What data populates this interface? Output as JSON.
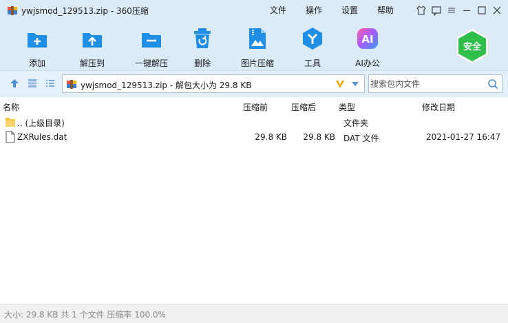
{
  "window": {
    "title": "ywjsmod_129513.zip - 360压缩",
    "menu": [
      "文件",
      "操作",
      "设置",
      "帮助"
    ]
  },
  "toolbar": {
    "items": [
      {
        "label": "添加",
        "icon": "add-archive-icon"
      },
      {
        "label": "解压到",
        "icon": "extract-to-icon"
      },
      {
        "label": "一键解压",
        "icon": "one-click-extract-icon"
      },
      {
        "label": "删除",
        "icon": "delete-icon"
      },
      {
        "label": "图片压缩",
        "icon": "image-compress-icon"
      },
      {
        "label": "工具",
        "icon": "tools-icon"
      },
      {
        "label": "AI办公",
        "icon": "ai-office-icon"
      }
    ],
    "ai_badge": "AI",
    "security_badge": "安全"
  },
  "address": {
    "path": "ywjsmod_129513.zip - 解包大小为 29.8 KB",
    "search_placeholder": "搜索包内文件"
  },
  "columns": {
    "name": "名称",
    "before": "压缩前",
    "after": "压缩后",
    "type": "类型",
    "date": "修改日期"
  },
  "files": [
    {
      "name": ".. (上级目录)",
      "before": "",
      "after": "",
      "type": "文件夹",
      "date": ""
    },
    {
      "name": "ZXRules.dat",
      "before": "29.8 KB",
      "after": "29.8 KB",
      "type": "DAT 文件",
      "date": "2021-01-27 16:47"
    }
  ],
  "status": {
    "text": "大小: 29.8 KB 共 1 个文件 压缩率 100.0%"
  },
  "colors": {
    "header_bg": "#dcebf9",
    "accent_blue": "#1e8ee6",
    "security_green": "#2fbf4a"
  }
}
